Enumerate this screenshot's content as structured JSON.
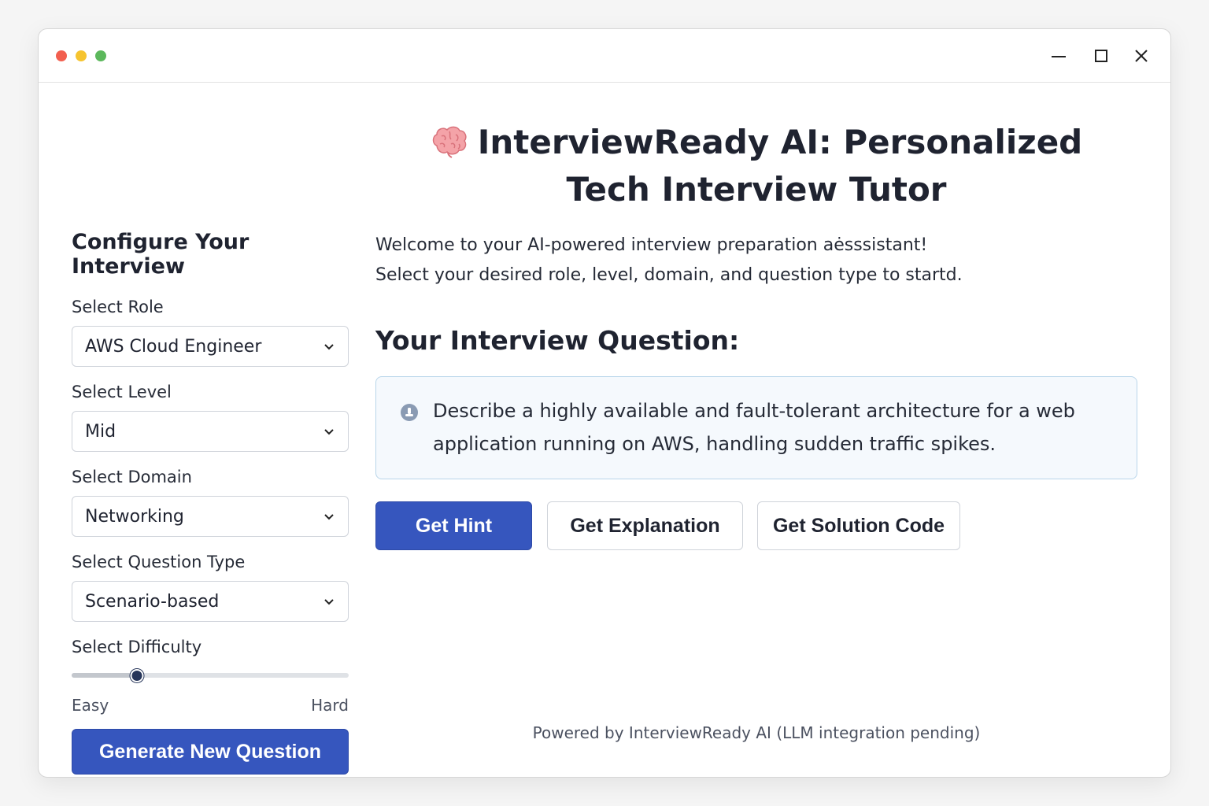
{
  "window": {
    "controls": {
      "minimize_icon": "minimize-icon",
      "maximize_icon": "maximize-icon",
      "close_icon": "close-icon"
    }
  },
  "sidebar": {
    "title": "Configure Your Interview",
    "role": {
      "label": "Select Role",
      "value": "AWS Cloud Engineer"
    },
    "level": {
      "label": "Select Level",
      "value": "Mid"
    },
    "domain": {
      "label": "Select Domain",
      "value": "Networking"
    },
    "question_type": {
      "label": "Select Question Type",
      "value": "Scenario-based"
    },
    "difficulty": {
      "label": "Select Difficulty",
      "min_label": "Easy",
      "max_label": "Hard",
      "value_fraction": 0.235
    },
    "generate_label": "Generate New Question"
  },
  "main": {
    "title_line1": "InterviewReady AI: Personalized",
    "title_line2": "Tech Interview Tutor",
    "welcome_line1": "Welcome to your AI-powered interview preparation aėsssistant!",
    "welcome_line2": "Select your desired role, level, domain, and question type to startd.",
    "question_heading": "Your Interview Question:",
    "question_text": "Describe a highly available and fault-tolerant architecture for a web application running on AWS, handling sudden traffic spikes.",
    "buttons": {
      "hint": "Get Hint",
      "explanation": "Get Explanation",
      "solution": "Get Solution Code"
    }
  },
  "footer": "Powered by InterviewReady AI (LLM integration pending)",
  "colors": {
    "primary": "#3656be",
    "info_bg": "#f5f9fd",
    "info_border": "#b9d6ea",
    "slider_thumb": "#27365a"
  }
}
